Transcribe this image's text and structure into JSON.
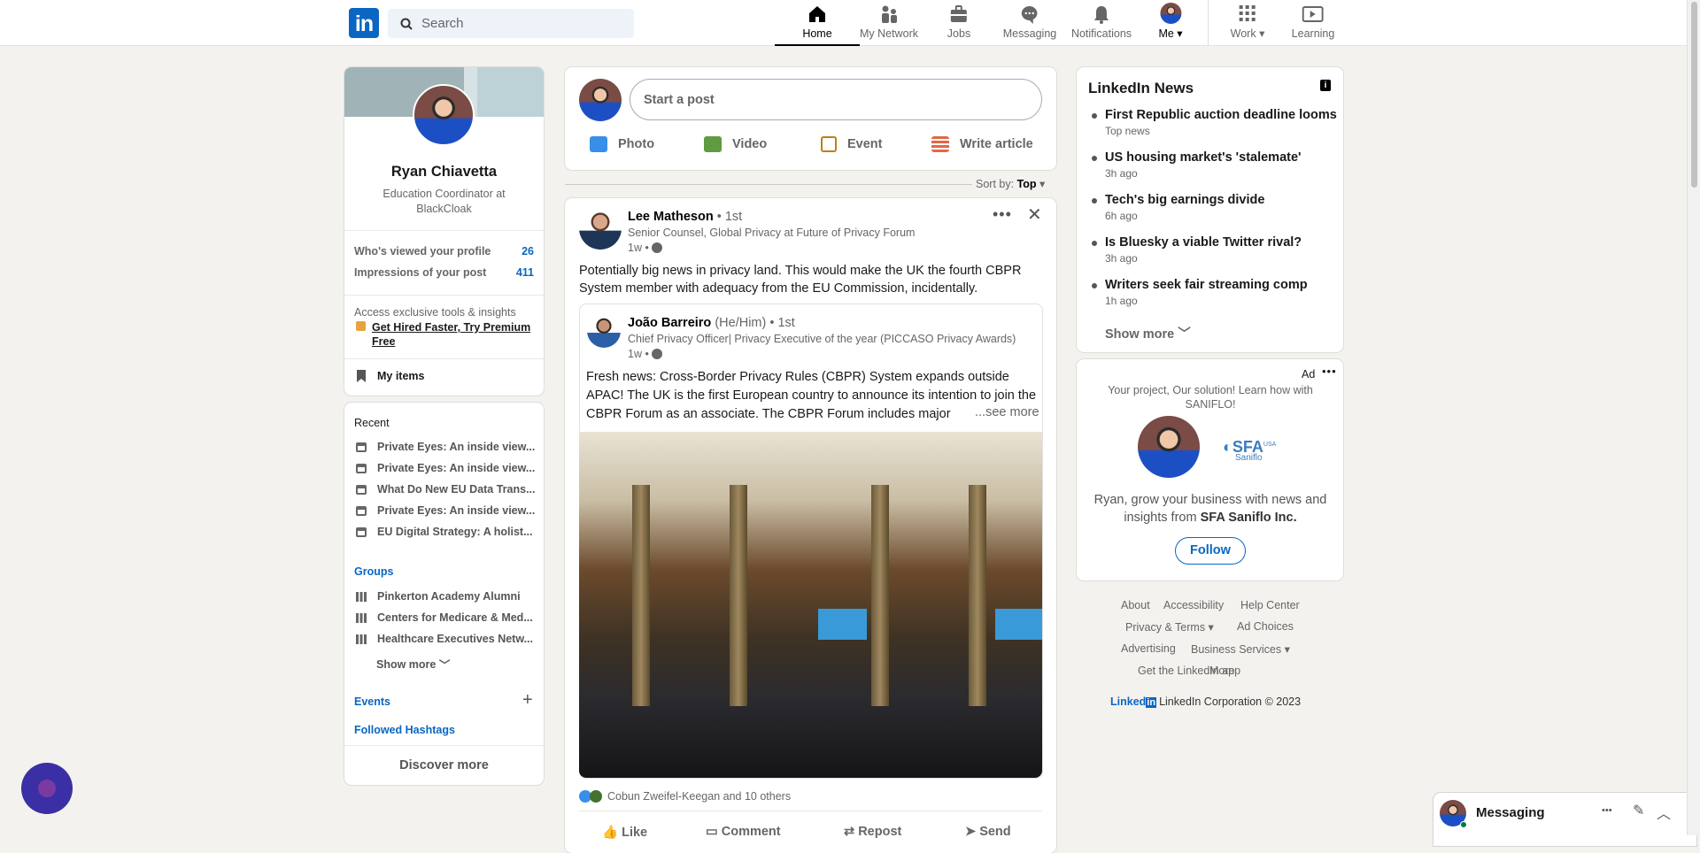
{
  "header": {
    "logo": "in",
    "search_placeholder": "Search",
    "nav": [
      {
        "label": "Home",
        "icon": "home-icon"
      },
      {
        "label": "My Network",
        "icon": "network-icon"
      },
      {
        "label": "Jobs",
        "icon": "briefcase-icon"
      },
      {
        "label": "Messaging",
        "icon": "chat-icon"
      },
      {
        "label": "Notifications",
        "icon": "bell-icon"
      },
      {
        "label": "Me",
        "icon": "avatar"
      },
      {
        "label": "Work",
        "icon": "grid-icon"
      },
      {
        "label": "Learning",
        "icon": "learning-icon"
      }
    ]
  },
  "profile": {
    "name": "Ryan Chiavetta",
    "headline": "Education Coordinator at BlackCloak",
    "stats": [
      {
        "label": "Who's viewed your profile",
        "value": "26"
      },
      {
        "label": "Impressions of your post",
        "value": "411"
      }
    ],
    "premium_text": "Access exclusive tools & insights",
    "premium_link": "Get Hired Faster, Try Premium Free",
    "my_items": "My items"
  },
  "sidebar": {
    "recent_title": "Recent",
    "recent": [
      "Private Eyes: An inside view...",
      "Private Eyes: An inside view...",
      "What Do New EU Data Trans...",
      "Private Eyes: An inside view...",
      "EU Digital Strategy: A holist..."
    ],
    "groups_title": "Groups",
    "groups": [
      "Pinkerton Academy Alumni",
      "Centers for Medicare & Med...",
      "Healthcare Executives Netw..."
    ],
    "show_more": "Show more",
    "events": "Events",
    "hashtags": "Followed Hashtags",
    "discover": "Discover more"
  },
  "share": {
    "placeholder": "Start a post",
    "actions": [
      "Photo",
      "Video",
      "Event",
      "Write article"
    ],
    "sort_label": "Sort by:",
    "sort_value": "Top"
  },
  "post": {
    "author": "Lee Matheson",
    "degree": "• 1st",
    "headline": "Senior Counsel, Global Privacy at Future of Privacy Forum",
    "time": "1w •",
    "text": "Potentially big news in privacy land. This would make the UK the fourth CBPR System member with adequacy from the EU Commission, incidentally.",
    "shared": {
      "author": "João Barreiro",
      "pronouns": "(He/Him)",
      "degree": "• 1st",
      "headline": "Chief Privacy Officer| Privacy Executive of the year (PICCASO Privacy Awards)",
      "time": "1w •",
      "text": "Fresh news: Cross-Border Privacy Rules (CBPR) System expands outside APAC! The UK is the first European country to announce its intention to join the CBPR Forum as an associate. The CBPR Forum includes major",
      "see_more": "...see more"
    },
    "reactions": "Cobun Zweifel-Keegan and 10 others",
    "actions": [
      "Like",
      "Comment",
      "Repost",
      "Send"
    ]
  },
  "news": {
    "title": "LinkedIn News",
    "items": [
      {
        "title": "First Republic auction deadline looms",
        "meta": "Top news"
      },
      {
        "title": "US housing market's 'stalemate'",
        "meta": "3h ago"
      },
      {
        "title": "Tech's big earnings divide",
        "meta": "6h ago"
      },
      {
        "title": "Is Bluesky a viable Twitter rival?",
        "meta": "3h ago"
      },
      {
        "title": "Writers seek fair streaming comp",
        "meta": "1h ago"
      }
    ],
    "show_more": "Show more"
  },
  "ad": {
    "label": "Ad",
    "tagline": "Your project, Our solution! Learn how with SANIFLO!",
    "logo_text": "SFA",
    "logo_sub": "Saniflo",
    "logo_usa": "USA",
    "body_pre": "Ryan, grow your business with news and insights from ",
    "body_company": "SFA Saniflo Inc.",
    "follow": "Follow"
  },
  "footer": {
    "links": [
      "About",
      "Accessibility",
      "Help Center",
      "Privacy & Terms",
      "Ad Choices",
      "Advertising",
      "Business Services",
      "Get the LinkedIn app",
      "More"
    ],
    "brand": "Linked",
    "copyright": "LinkedIn Corporation © 2023"
  },
  "messaging": {
    "title": "Messaging"
  }
}
